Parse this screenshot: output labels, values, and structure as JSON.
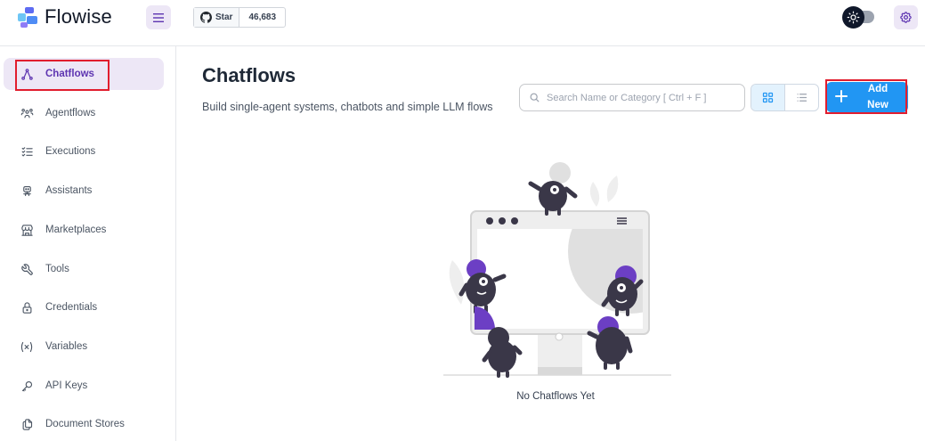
{
  "header": {
    "app_name": "Flowise",
    "github": {
      "star_label": "Star",
      "star_count": "46,683"
    }
  },
  "sidebar": {
    "items": [
      {
        "label": "Chatflows",
        "icon": "hierarchy-icon",
        "active": true
      },
      {
        "label": "Agentflows",
        "icon": "users-group-icon",
        "active": false
      },
      {
        "label": "Executions",
        "icon": "list-check-icon",
        "active": false
      },
      {
        "label": "Assistants",
        "icon": "robot-icon",
        "active": false
      },
      {
        "label": "Marketplaces",
        "icon": "building-store-icon",
        "active": false
      },
      {
        "label": "Tools",
        "icon": "tool-icon",
        "active": false
      },
      {
        "label": "Credentials",
        "icon": "lock-icon",
        "active": false
      },
      {
        "label": "Variables",
        "icon": "variable-icon",
        "active": false
      },
      {
        "label": "API Keys",
        "icon": "key-icon",
        "active": false
      },
      {
        "label": "Document Stores",
        "icon": "files-icon",
        "active": false
      }
    ]
  },
  "main": {
    "title": "Chatflows",
    "subtitle": "Build single-agent systems, chatbots and simple LLM flows",
    "search": {
      "placeholder": "Search Name or Category [ Ctrl + F ]",
      "value": ""
    },
    "view_mode": "card",
    "add_button": {
      "label_line1": "Add",
      "label_line2": "New"
    },
    "empty_state": "No Chatflows Yet"
  },
  "colors": {
    "accent_purple": "#5e35b1",
    "accent_purple_light": "#ede7f6",
    "primary_blue": "#2196f3",
    "highlight_red": "#e11d2e"
  }
}
